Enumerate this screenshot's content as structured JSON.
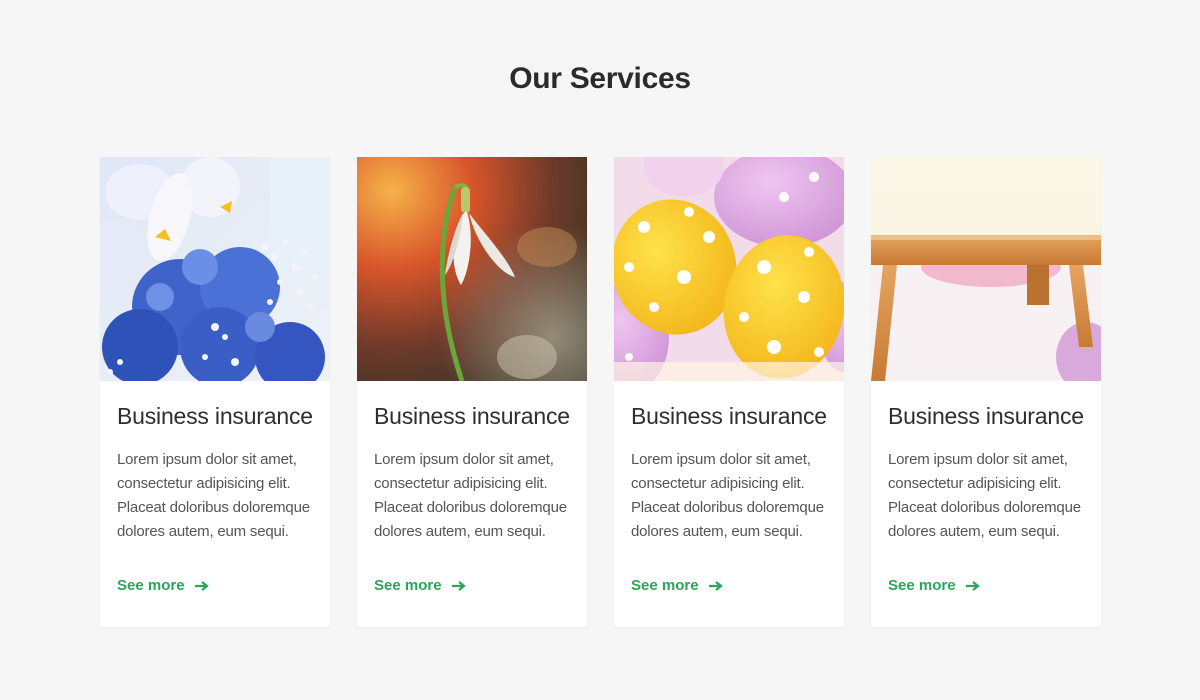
{
  "section": {
    "title": "Our Services"
  },
  "colors": {
    "background": "#f6f6f6",
    "card": "#ffffff",
    "accent": "#2aa65a",
    "title": "#2b2b2b"
  },
  "cards": [
    {
      "image": "blue-iris-flowers-photo",
      "title": "Business insurance",
      "text": "Lorem ipsum dolor sit amet, consectetur adipisicing elit. Placeat doloribus doloremque dolores autem, eum sequi.",
      "link_label": "See more",
      "link_icon": "arrow-right-icon"
    },
    {
      "image": "snowdrop-flower-photo",
      "title": "Business insurance",
      "text": "Lorem ipsum dolor sit amet, consectetur adipisicing elit. Placeat doloribus doloremque dolores autem, eum sequi.",
      "link_label": "See more",
      "link_icon": "arrow-right-icon"
    },
    {
      "image": "easter-eggs-photo",
      "title": "Business insurance",
      "text": "Lorem ipsum dolor sit amet, consectetur adipisicing elit. Placeat doloribus doloremque dolores autem, eum sequi.",
      "link_label": "See more",
      "link_icon": "arrow-right-icon"
    },
    {
      "image": "wooden-easel-photo",
      "title": "Business insurance",
      "text": "Lorem ipsum dolor sit amet, consectetur adipisicing elit. Placeat doloribus doloremque dolores autem, eum sequi.",
      "link_label": "See more",
      "link_icon": "arrow-right-icon"
    }
  ]
}
